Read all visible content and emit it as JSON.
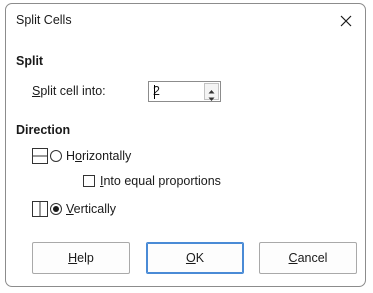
{
  "window": {
    "title": "Split Cells",
    "close_symbol": "✕"
  },
  "split": {
    "heading": "Split",
    "label_mnemonic": "S",
    "label_rest": "plit cell into:",
    "value": "2"
  },
  "direction": {
    "heading": "Direction",
    "horizontal": {
      "pre": "H",
      "mnemonic": "o",
      "post": "rizontally",
      "selected": false
    },
    "equal": {
      "mnemonic": "I",
      "post": "nto equal proportions",
      "checked": false
    },
    "vertical": {
      "mnemonic": "V",
      "post": "ertically",
      "selected": true
    }
  },
  "buttons": {
    "help": {
      "mnemonic": "H",
      "rest": "elp"
    },
    "ok": {
      "mnemonic": "O",
      "rest": "K"
    },
    "cancel": {
      "mnemonic": "C",
      "rest": "ancel"
    }
  },
  "colors": {
    "default_button_border": "#4a8bd6",
    "border": "#8c8c8c"
  }
}
